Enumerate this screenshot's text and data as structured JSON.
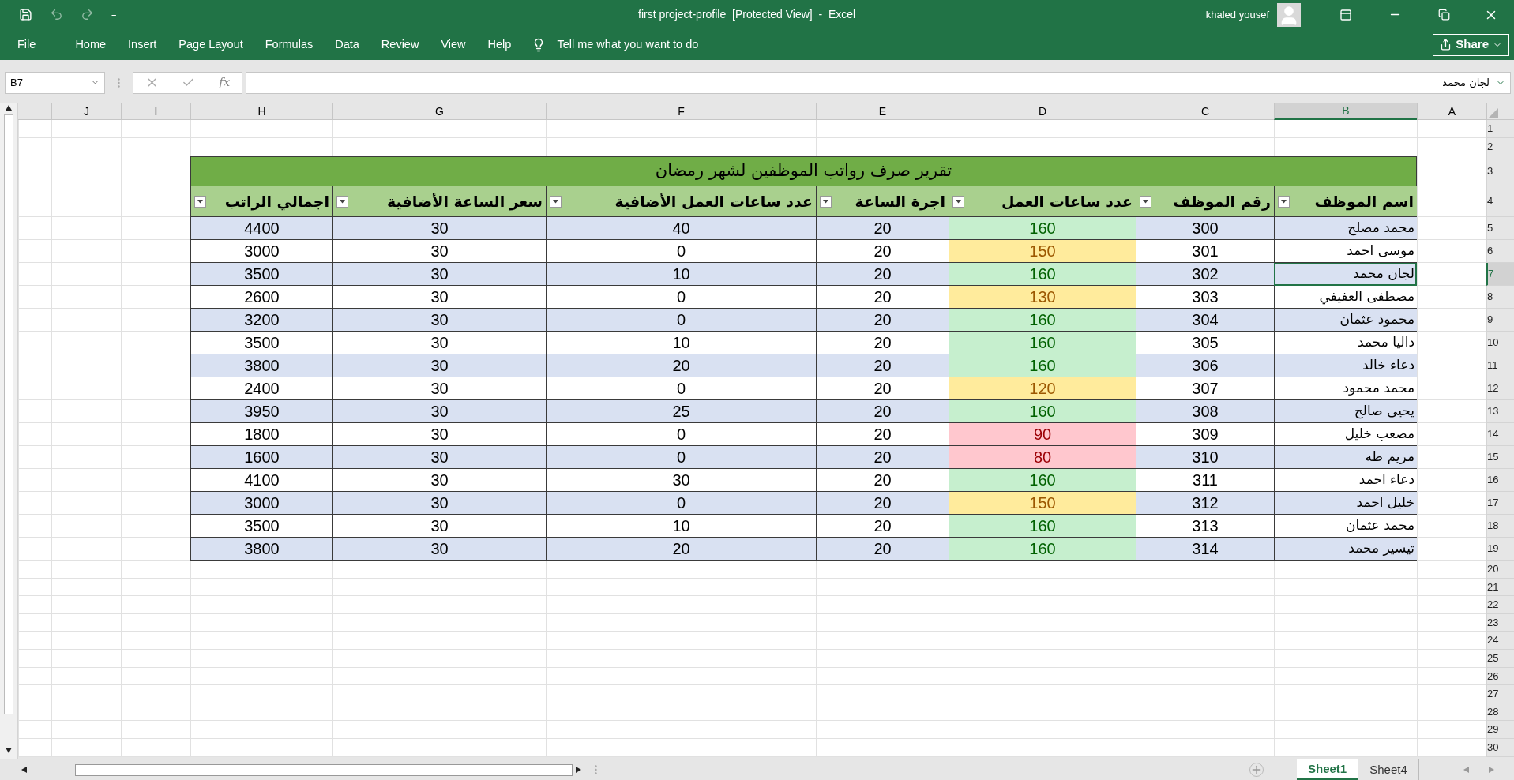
{
  "window": {
    "title": "first project-profile  [Protected View]  -  Excel",
    "user": "khaled yousef"
  },
  "quick_access": {
    "customize": "="
  },
  "ribbon": {
    "tabs": [
      {
        "label": "File"
      },
      {
        "label": "Home"
      },
      {
        "label": "Insert"
      },
      {
        "label": "Page Layout"
      },
      {
        "label": "Formulas"
      },
      {
        "label": "Data"
      },
      {
        "label": "Review"
      },
      {
        "label": "View"
      },
      {
        "label": "Help"
      }
    ],
    "tell_me": "Tell me what you want to do",
    "share": "Share"
  },
  "formula_bar": {
    "name_box": "B7",
    "fx": "fx",
    "value": "لجان محمد"
  },
  "columns": [
    {
      "label": "J",
      "selected": false
    },
    {
      "label": "I",
      "selected": false
    },
    {
      "label": "H",
      "selected": false
    },
    {
      "label": "G",
      "selected": false
    },
    {
      "label": "F",
      "selected": false
    },
    {
      "label": "E",
      "selected": false
    },
    {
      "label": "D",
      "selected": false
    },
    {
      "label": "C",
      "selected": false
    },
    {
      "label": "B",
      "selected": true
    },
    {
      "label": "A",
      "selected": false
    }
  ],
  "rows": [
    {
      "kind": "blank",
      "label": "1",
      "selected": false
    },
    {
      "kind": "blank",
      "label": "2",
      "selected": false
    },
    {
      "kind": "title",
      "label": "3",
      "selected": false,
      "text": "تقرير صرف رواتب الموظفين لشهر رمضان"
    },
    {
      "kind": "header",
      "label": "4",
      "selected": false,
      "cells": [
        "اسم الموظف",
        "رقم الموظف",
        "عدد ساعات العمل",
        "اجرة الساعة",
        "عدد ساعات العمل الأضافية",
        "سعر الساعة الأضافية",
        "اجمالي الراتب"
      ]
    },
    {
      "kind": "data",
      "label": "5",
      "selected": false,
      "name": "محمد مصلح",
      "id": "300",
      "hours": {
        "value": "160",
        "color": "#c6efce"
      },
      "rate": "20",
      "overtime_hours": "40",
      "overtime_rate": "30",
      "total": "4400"
    },
    {
      "kind": "data",
      "label": "6",
      "selected": false,
      "name": "موسى احمد",
      "id": "301",
      "hours": {
        "value": "150",
        "color": "#ffeb9c"
      },
      "rate": "20",
      "overtime_hours": "0",
      "overtime_rate": "30",
      "total": "3000"
    },
    {
      "kind": "data",
      "label": "7",
      "selected": true,
      "name": "لجان محمد",
      "id": "302",
      "hours": {
        "value": "160",
        "color": "#c6efce"
      },
      "rate": "20",
      "overtime_hours": "10",
      "overtime_rate": "30",
      "total": "3500"
    },
    {
      "kind": "data",
      "label": "8",
      "selected": false,
      "name": "مصطفى العفيفي",
      "id": "303",
      "hours": {
        "value": "130",
        "color": "#ffeb9c"
      },
      "rate": "20",
      "overtime_hours": "0",
      "overtime_rate": "30",
      "total": "2600"
    },
    {
      "kind": "data",
      "label": "9",
      "selected": false,
      "name": "محمود عثمان",
      "id": "304",
      "hours": {
        "value": "160",
        "color": "#c6efce"
      },
      "rate": "20",
      "overtime_hours": "0",
      "overtime_rate": "30",
      "total": "3200"
    },
    {
      "kind": "data",
      "label": "10",
      "selected": false,
      "name": "داليا محمد",
      "id": "305",
      "hours": {
        "value": "160",
        "color": "#c6efce"
      },
      "rate": "20",
      "overtime_hours": "10",
      "overtime_rate": "30",
      "total": "3500"
    },
    {
      "kind": "data",
      "label": "11",
      "selected": false,
      "name": "دعاء خالد",
      "id": "306",
      "hours": {
        "value": "160",
        "color": "#c6efce"
      },
      "rate": "20",
      "overtime_hours": "20",
      "overtime_rate": "30",
      "total": "3800"
    },
    {
      "kind": "data",
      "label": "12",
      "selected": false,
      "name": "محمد محمود",
      "id": "307",
      "hours": {
        "value": "120",
        "color": "#ffeb9c"
      },
      "rate": "20",
      "overtime_hours": "0",
      "overtime_rate": "30",
      "total": "2400"
    },
    {
      "kind": "data",
      "label": "13",
      "selected": false,
      "name": "يحيى صالح",
      "id": "308",
      "hours": {
        "value": "160",
        "color": "#c6efce"
      },
      "rate": "20",
      "overtime_hours": "25",
      "overtime_rate": "30",
      "total": "3950"
    },
    {
      "kind": "data",
      "label": "14",
      "selected": false,
      "name": "مصعب خليل",
      "id": "309",
      "hours": {
        "value": "90",
        "color": "#ffc7ce"
      },
      "rate": "20",
      "overtime_hours": "0",
      "overtime_rate": "30",
      "total": "1800"
    },
    {
      "kind": "data",
      "label": "15",
      "selected": false,
      "name": "مريم طه",
      "id": "310",
      "hours": {
        "value": "80",
        "color": "#ffc7ce"
      },
      "rate": "20",
      "overtime_hours": "0",
      "overtime_rate": "30",
      "total": "1600"
    },
    {
      "kind": "data",
      "label": "16",
      "selected": false,
      "name": "دعاء احمد",
      "id": "311",
      "hours": {
        "value": "160",
        "color": "#c6efce"
      },
      "rate": "20",
      "overtime_hours": "30",
      "overtime_rate": "30",
      "total": "4100"
    },
    {
      "kind": "data",
      "label": "17",
      "selected": false,
      "name": "خليل احمد",
      "id": "312",
      "hours": {
        "value": "150",
        "color": "#ffeb9c"
      },
      "rate": "20",
      "overtime_hours": "0",
      "overtime_rate": "30",
      "total": "3000"
    },
    {
      "kind": "data",
      "label": "18",
      "selected": false,
      "name": "محمد عثمان",
      "id": "313",
      "hours": {
        "value": "160",
        "color": "#c6efce"
      },
      "rate": "20",
      "overtime_hours": "10",
      "overtime_rate": "30",
      "total": "3500"
    },
    {
      "kind": "data",
      "label": "19",
      "selected": false,
      "name": "تيسير محمد",
      "id": "314",
      "hours": {
        "value": "160",
        "color": "#c6efce"
      },
      "rate": "20",
      "overtime_hours": "20",
      "overtime_rate": "30",
      "total": "3800"
    },
    {
      "kind": "blank",
      "label": "20",
      "selected": false
    },
    {
      "kind": "blank",
      "label": "21",
      "selected": false
    },
    {
      "kind": "blank",
      "label": "22",
      "selected": false
    },
    {
      "kind": "blank",
      "label": "23",
      "selected": false
    },
    {
      "kind": "blank",
      "label": "24",
      "selected": false
    },
    {
      "kind": "blank",
      "label": "25",
      "selected": false
    },
    {
      "kind": "blank",
      "label": "26",
      "selected": false
    },
    {
      "kind": "blank",
      "label": "27",
      "selected": false
    },
    {
      "kind": "blank",
      "label": "28",
      "selected": false
    },
    {
      "kind": "blank",
      "label": "29",
      "selected": false
    },
    {
      "kind": "blank",
      "label": "30",
      "selected": false
    }
  ],
  "sheets": [
    {
      "label": "Sheet1",
      "selected": true
    },
    {
      "label": "Sheet4",
      "selected": false
    }
  ]
}
